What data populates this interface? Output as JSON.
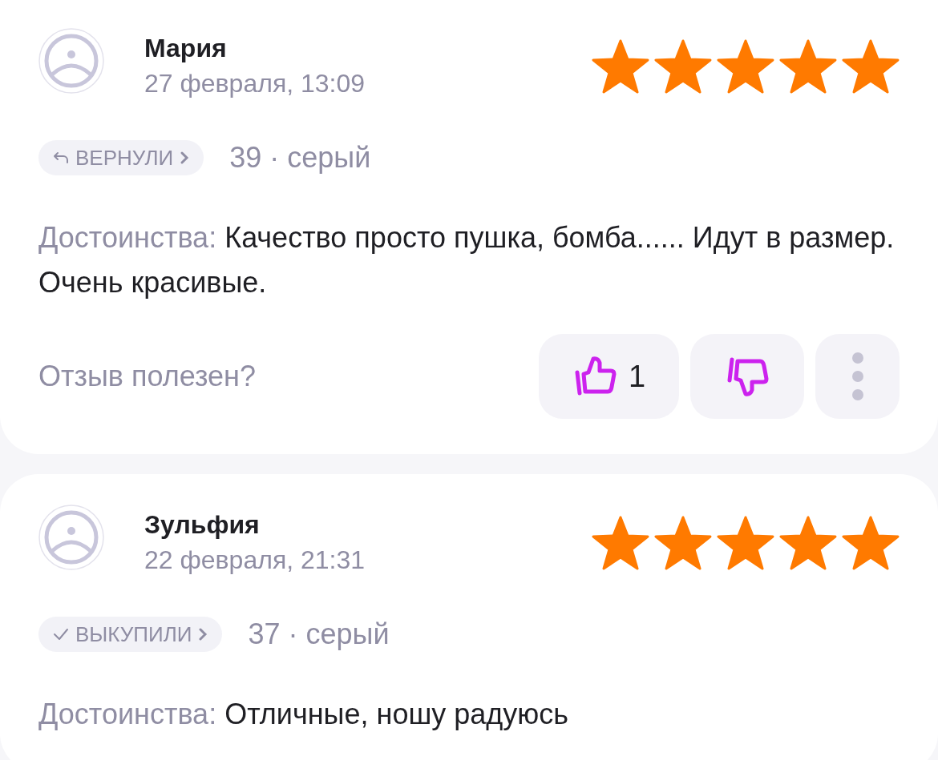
{
  "reviews": [
    {
      "name": "Мария",
      "date": "27 февраля, 13:09",
      "stars": 5,
      "badge": {
        "kind": "returned",
        "label": "ВЕРНУЛИ"
      },
      "size": "39 · серый",
      "pros_label": "Достоинства:",
      "pros_text": "Качество просто пушка, бомба...... Идут в размер. Очень красивые.",
      "helpful": {
        "question": "Отзыв полезен?",
        "likes": "1"
      }
    },
    {
      "name": "Зульфия",
      "date": "22 февраля, 21:31",
      "stars": 5,
      "badge": {
        "kind": "bought",
        "label": "ВЫКУПИЛИ"
      },
      "size": "37 · серый",
      "pros_label": "Достоинства:",
      "pros_text": "Отличные, ношу радуюсь"
    }
  ]
}
